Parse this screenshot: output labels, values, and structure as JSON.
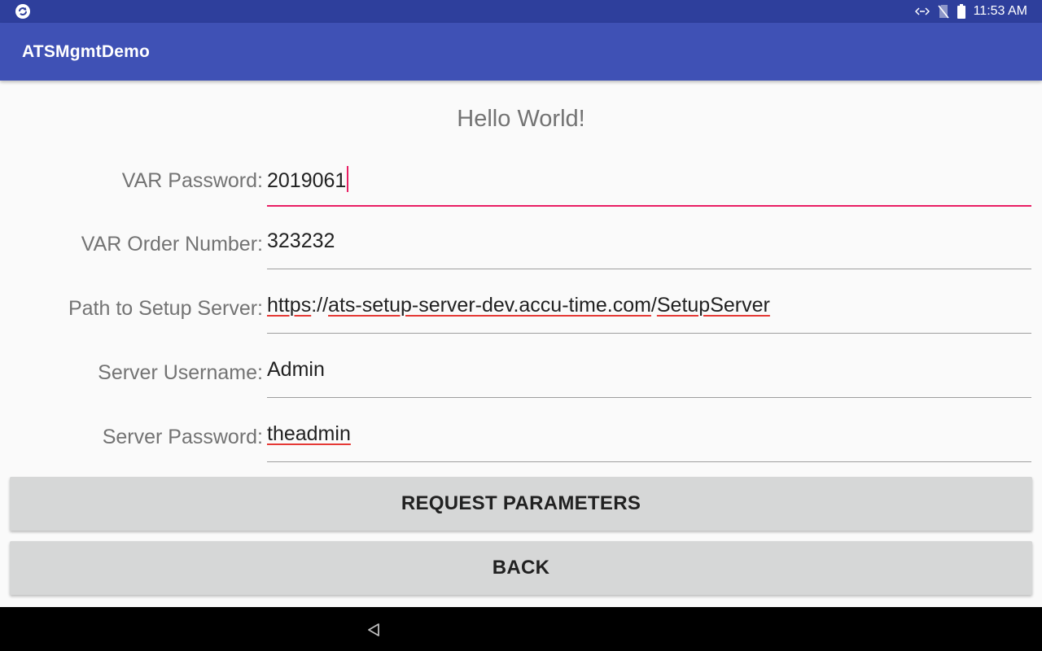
{
  "status_bar": {
    "time": "11:53 AM",
    "icons": [
      "app-sync-icon",
      "data-arrows-icon",
      "no-sim-icon",
      "battery-icon"
    ]
  },
  "app_bar": {
    "title": "ATSMgmtDemo"
  },
  "main": {
    "heading": "Hello World!",
    "fields": [
      {
        "label": "VAR Password:",
        "value": "2019061",
        "focused": true
      },
      {
        "label": "VAR Order Number:",
        "value": "323232"
      },
      {
        "label": "Path to Setup Server:",
        "value_parts": [
          "https",
          "://",
          "ats-setup-server-dev.accu-time.com",
          "/",
          "SetupServer"
        ]
      },
      {
        "label": "Server Username:",
        "value": "Admin"
      },
      {
        "label": "Server Password:",
        "value": "theadmin"
      }
    ],
    "buttons": {
      "request": "REQUEST PARAMETERS",
      "back": "BACK"
    }
  },
  "nav_bar": {
    "icons": [
      "back-triangle-icon"
    ]
  },
  "colors": {
    "status_bar": "#2e3f9c",
    "app_bar": "#3f51b5",
    "accent": "#e91e63",
    "button": "#d6d7d7"
  }
}
